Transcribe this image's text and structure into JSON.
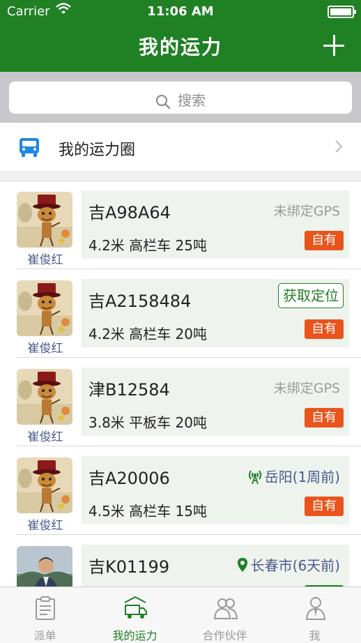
{
  "status_bar": {
    "carrier": "Carrier",
    "time": "11:06 AM"
  },
  "nav": {
    "title": "我的运力",
    "add_icon": "plus-icon"
  },
  "search": {
    "placeholder": "搜索"
  },
  "capacity_circle": {
    "label": "我的运力圈"
  },
  "vehicles": [
    {
      "owner": "崔俊红",
      "plate": "吉A98A64",
      "spec": "4.2米 高栏车 25吨",
      "gps_status": "未绑定GPS",
      "badge": "自有"
    },
    {
      "owner": "崔俊红",
      "plate": "吉A2158484",
      "spec": "4.2米 高栏车 20吨",
      "action": "获取定位",
      "badge": "自有"
    },
    {
      "owner": "崔俊红",
      "plate": "津B12584",
      "spec": "3.8米 平板车 20吨",
      "gps_status": "未绑定GPS",
      "badge": "自有"
    },
    {
      "owner": "崔俊红",
      "plate": "吉A20006",
      "spec": "4.5米 高栏车 15吨",
      "location": "岳阳(1周前)",
      "badge": "自有"
    },
    {
      "owner": "",
      "plate": "吉K01199",
      "spec": "",
      "location": "长春市(6天前)",
      "badge": ""
    }
  ],
  "tabs": [
    {
      "label": "派单",
      "icon": "clipboard-icon"
    },
    {
      "label": "我的运力",
      "icon": "truck-icon",
      "active": true
    },
    {
      "label": "合作伙伴",
      "icon": "partners-icon"
    },
    {
      "label": "我",
      "icon": "person-icon"
    }
  ],
  "colors": {
    "primary": "#1f8024",
    "badge": "#e8541c",
    "card_bg": "#eef3ee",
    "link": "#4a5a8a"
  }
}
